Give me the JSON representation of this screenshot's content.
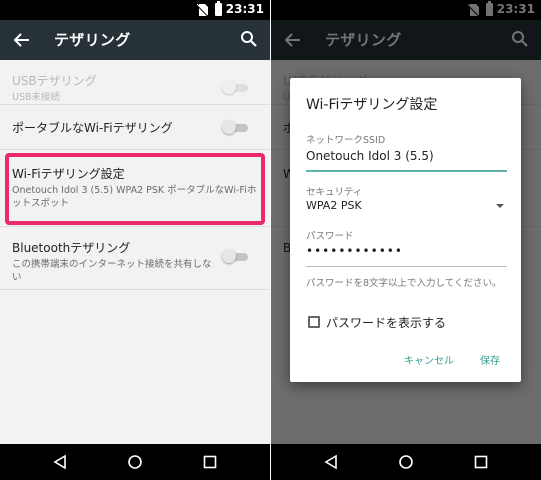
{
  "status_bar": {
    "time": "23:31"
  },
  "settings_screen": {
    "title": "テザリング",
    "items": [
      {
        "title": "USBテザリング",
        "summary": "USB未接続",
        "enabled": false
      },
      {
        "title": "ポータブルなWi-Fiテザリング",
        "summary": "",
        "enabled": true
      },
      {
        "title": "Wi-Fiテザリング設定",
        "summary": "Onetouch Idol 3 (5.5) WPA2 PSK ポータブルなWi-Fiホットスポット",
        "enabled": true
      },
      {
        "title": "Bluetoothテザリング",
        "summary": "この携帯端末のインターネット接続を共有しない",
        "enabled": true
      }
    ]
  },
  "dialog": {
    "title": "Wi-Fiテザリング設定",
    "ssid_label": "ネットワークSSID",
    "ssid_value": "Onetouch Idol 3 (5.5)",
    "security_label": "セキュリティ",
    "security_value": "WPA2 PSK",
    "password_label": "パスワード",
    "password_value": "••••••••••••",
    "password_hint": "パスワードを8文字以上で入力してください。",
    "show_password_label": "パスワードを表示する",
    "cancel_label": "キャンセル",
    "save_label": "保存"
  },
  "colors": {
    "app_bar": "#263238",
    "highlight": "#ec2a6b",
    "accent": "#339f91"
  },
  "icons": [
    "back-arrow-icon",
    "search-icon",
    "sim-icon",
    "battery-icon",
    "nav-back-icon",
    "nav-home-icon",
    "nav-recents-icon",
    "dropdown-arrow-icon",
    "checkbox-icon"
  ]
}
